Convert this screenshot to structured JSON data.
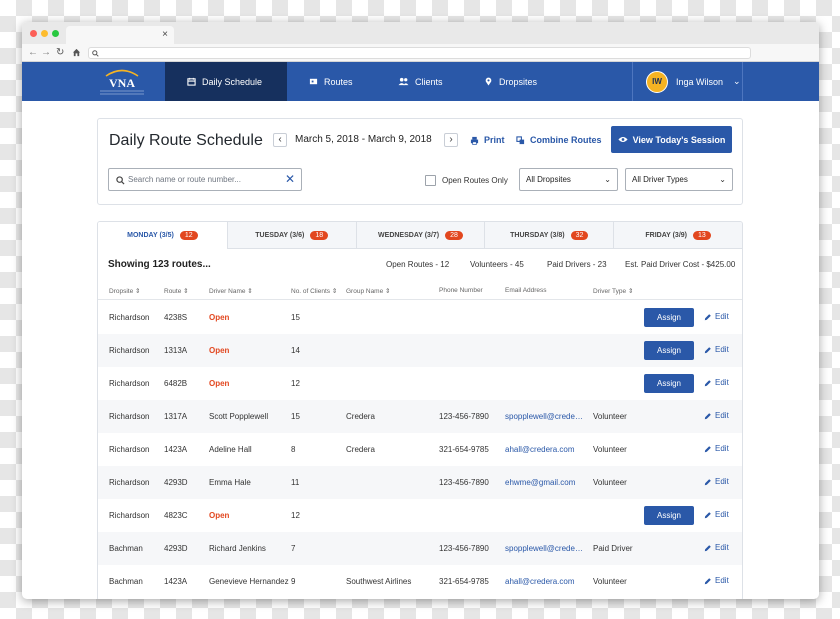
{
  "browser": {
    "tab_close": "×"
  },
  "app": {
    "brand": "VNA",
    "nav": [
      {
        "label": "Daily Schedule",
        "icon": "calendar-icon"
      },
      {
        "label": "Routes",
        "icon": "routes-icon"
      },
      {
        "label": "Clients",
        "icon": "people-icon"
      },
      {
        "label": "Dropsites",
        "icon": "map-pin-icon"
      }
    ],
    "user": {
      "initials": "IW",
      "name": "Inga Wilson"
    },
    "accent": "#2a58a8",
    "badge_color": "#e2471f"
  },
  "schedule": {
    "title": "Daily Route Schedule",
    "prev": "‹",
    "next": "›",
    "date_range": "March 5, 2018 - March 9, 2018",
    "print_label": "Print",
    "combine_label": "Combine Routes",
    "session_label": "View Today's Session",
    "search_placeholder": "Search name or route number...",
    "open_routes_label": "Open Routes Only",
    "dropsite_filter": "All Dropsites",
    "driver_filter": "All Driver Types"
  },
  "days": [
    {
      "label": "MONDAY (3/5)",
      "count": "12"
    },
    {
      "label": "TUESDAY (3/6)",
      "count": "18"
    },
    {
      "label": "WEDNESDAY (3/7)",
      "count": "28"
    },
    {
      "label": "THURSDAY (3/8)",
      "count": "32"
    },
    {
      "label": "FRIDAY (3/9)",
      "count": "13"
    }
  ],
  "summary": {
    "showing": "Showing 123 routes...",
    "open_routes": "Open Routes - 12",
    "volunteers": "Volunteers - 45",
    "paid_drivers": "Paid Drivers - 23",
    "est_cost": "Est. Paid Driver Cost - $425.00"
  },
  "columns": [
    "Dropsite",
    "Route",
    "Driver Name",
    "No. of Clients",
    "Group Name",
    "Phone Number",
    "Email Address",
    "Driver Type"
  ],
  "sortable_mark": "⇕",
  "assign_label": "Assign",
  "edit_label": "Edit",
  "rows": [
    {
      "dropsite": "Richardson",
      "route": "4238S",
      "driver": "Open",
      "clients": "15",
      "group": "",
      "phone": "",
      "email": "",
      "type": "",
      "open": true
    },
    {
      "dropsite": "Richardson",
      "route": "1313A",
      "driver": "Open",
      "clients": "14",
      "group": "",
      "phone": "",
      "email": "",
      "type": "",
      "open": true
    },
    {
      "dropsite": "Richardson",
      "route": "6482B",
      "driver": "Open",
      "clients": "12",
      "group": "",
      "phone": "",
      "email": "",
      "type": "",
      "open": true
    },
    {
      "dropsite": "Richardson",
      "route": "1317A",
      "driver": "Scott Popplewell",
      "clients": "15",
      "group": "Credera",
      "phone": "123-456-7890",
      "email": "spopplewell@credera.com",
      "type": "Volunteer",
      "open": false
    },
    {
      "dropsite": "Richardson",
      "route": "1423A",
      "driver": "Adeline Hall",
      "clients": "8",
      "group": "Credera",
      "phone": "321-654-9785",
      "email": "ahall@credera.com",
      "type": "Volunteer",
      "open": false
    },
    {
      "dropsite": "Richardson",
      "route": "4293D",
      "driver": "Emma Hale",
      "clients": "11",
      "group": "",
      "phone": "123-456-7890",
      "email": "ehwme@gmail.com",
      "type": "Volunteer",
      "open": false
    },
    {
      "dropsite": "Richardson",
      "route": "4823C",
      "driver": "Open",
      "clients": "12",
      "group": "",
      "phone": "",
      "email": "",
      "type": "",
      "open": true
    },
    {
      "dropsite": "Bachman",
      "route": "4293D",
      "driver": "Richard Jenkins",
      "clients": "7",
      "group": "",
      "phone": "123-456-7890",
      "email": "spopplewell@credera.com",
      "type": "Paid Driver",
      "open": false
    },
    {
      "dropsite": "Bachman",
      "route": "1423A",
      "driver": "Genevieve Hernandez",
      "clients": "9",
      "group": "Southwest Airlines",
      "phone": "321-654-9785",
      "email": "ahall@credera.com",
      "type": "Volunteer",
      "open": false
    }
  ]
}
